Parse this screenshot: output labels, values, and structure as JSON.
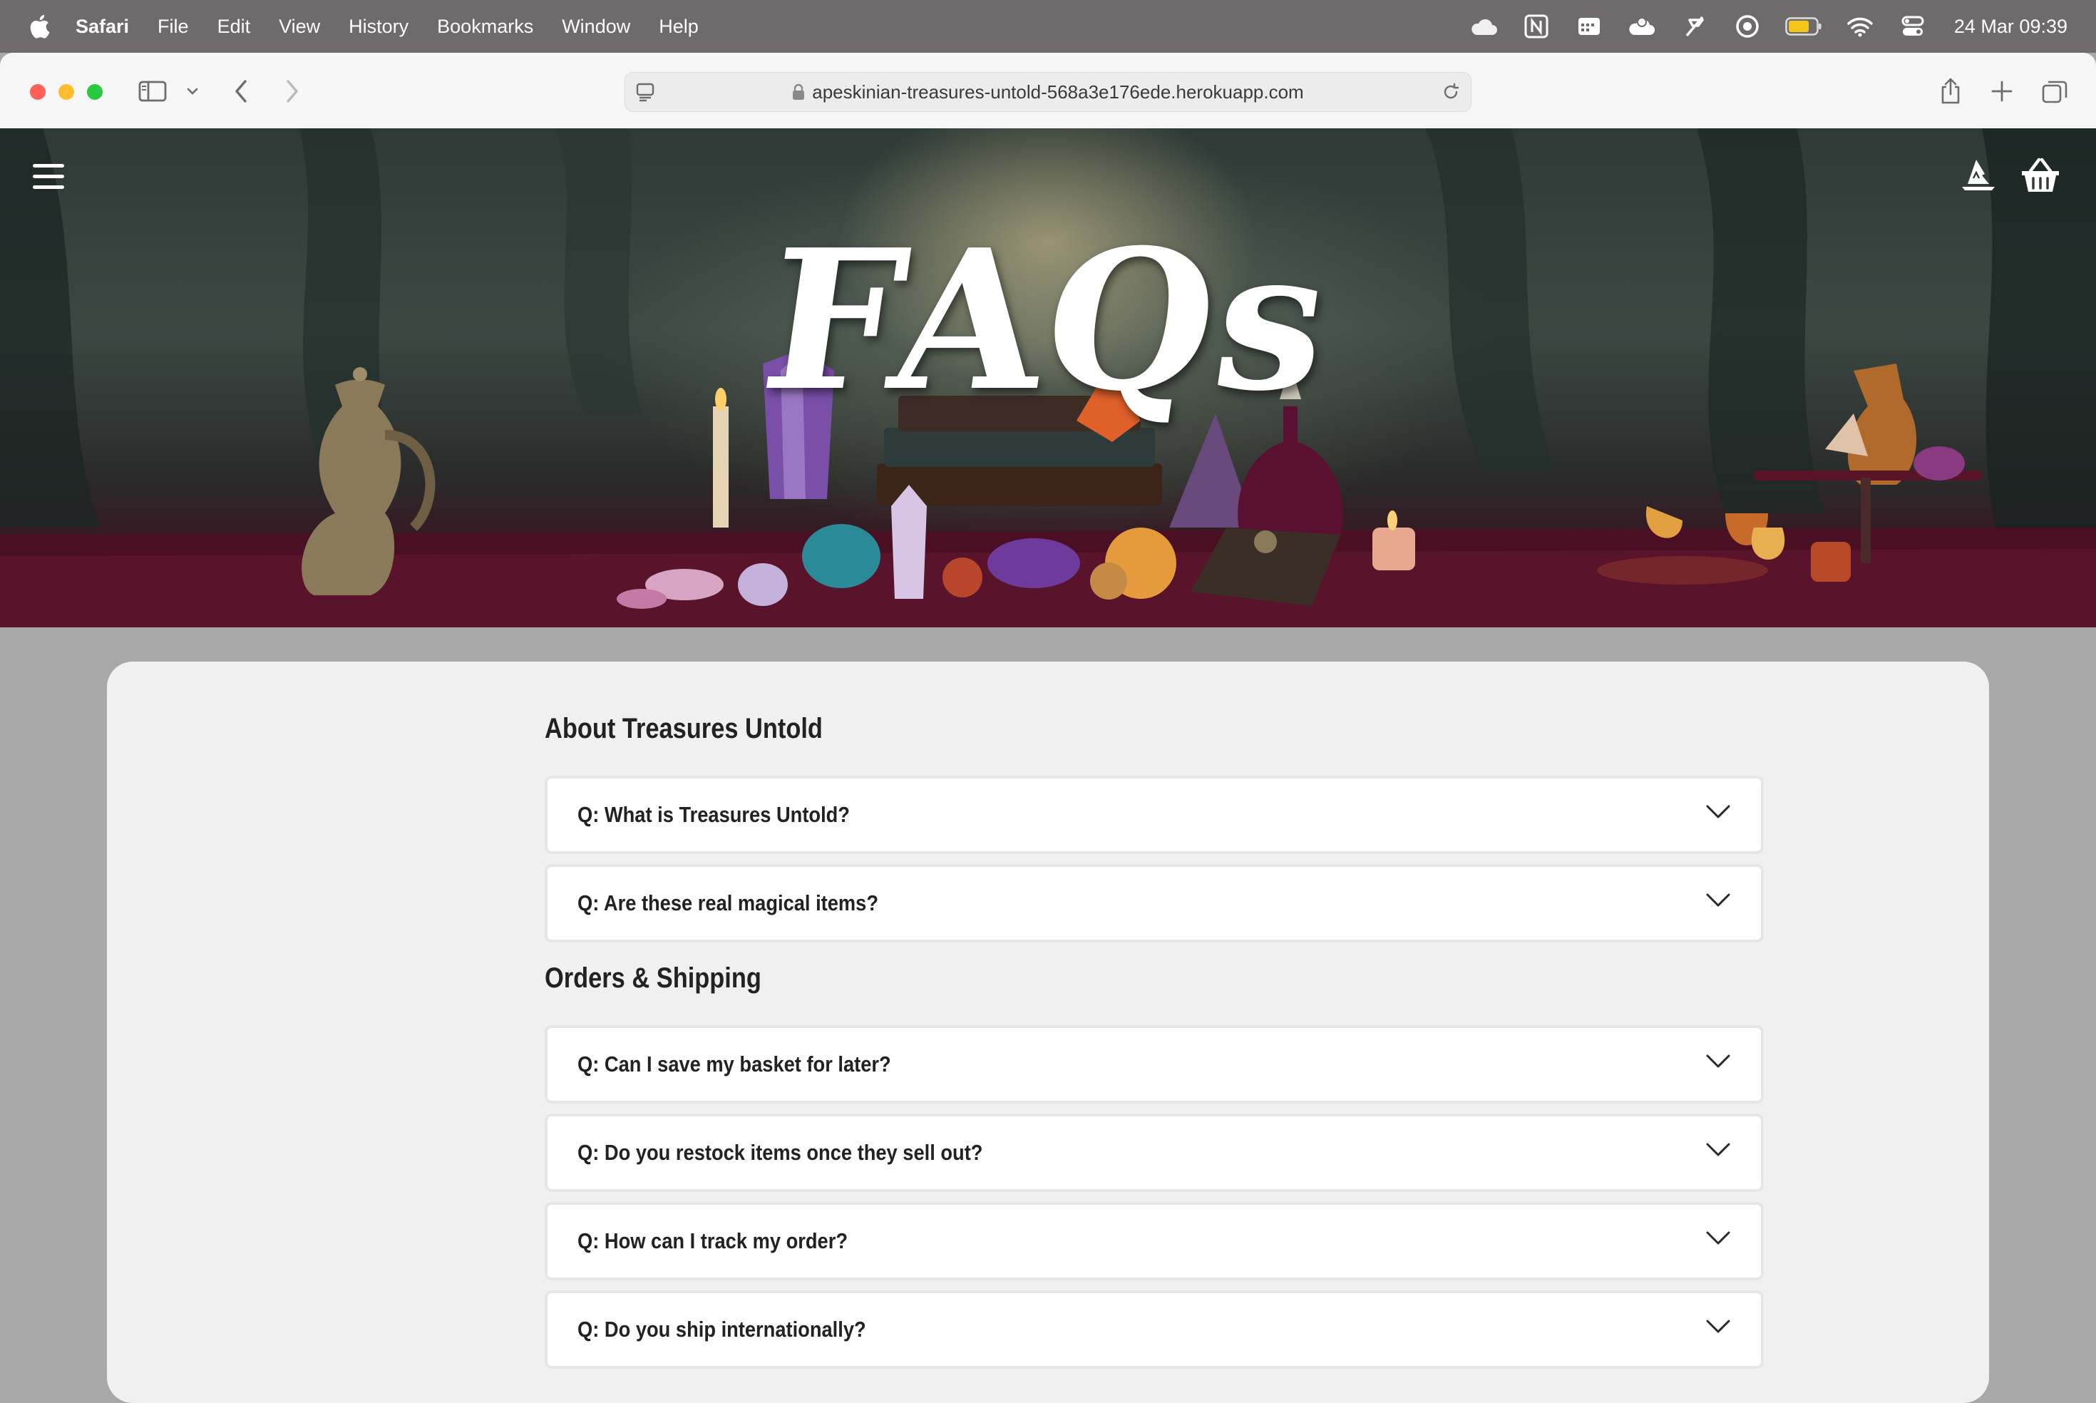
{
  "menubar": {
    "app": "Safari",
    "items": [
      "File",
      "Edit",
      "View",
      "History",
      "Bookmarks",
      "Window",
      "Help"
    ],
    "clock": "24 Mar  09:39"
  },
  "browser": {
    "url": "apeskinian-treasures-untold-568a3e176ede.herokuapp.com"
  },
  "hero": {
    "title": "FAQs"
  },
  "sections": [
    {
      "title": "About Treasures Untold",
      "questions": [
        "Q: What is Treasures Untold?",
        "Q: Are these real magical items?"
      ]
    },
    {
      "title": "Orders & Shipping",
      "questions": [
        "Q: Can I save my basket for later?",
        "Q: Do you restock items once they sell out?",
        "Q: How can I track my order?",
        "Q: Do you ship internationally?"
      ]
    }
  ],
  "icons": {
    "menubar_right": [
      "cloud-icon",
      "notion-icon",
      "calendar-icon",
      "cloud-sync-icon",
      "flag-icon",
      "record-icon",
      "battery-icon",
      "wifi-icon",
      "control-center-icon"
    ],
    "hero": [
      "hamburger-menu-icon",
      "wizard-hat-icon",
      "basket-icon"
    ]
  },
  "colors": {
    "menubar": "#6f6b6c",
    "toolbar": "#f6f6f6",
    "card": "#f0f0f0",
    "faq_item": "#ffffff",
    "text_dark": "#222222"
  }
}
